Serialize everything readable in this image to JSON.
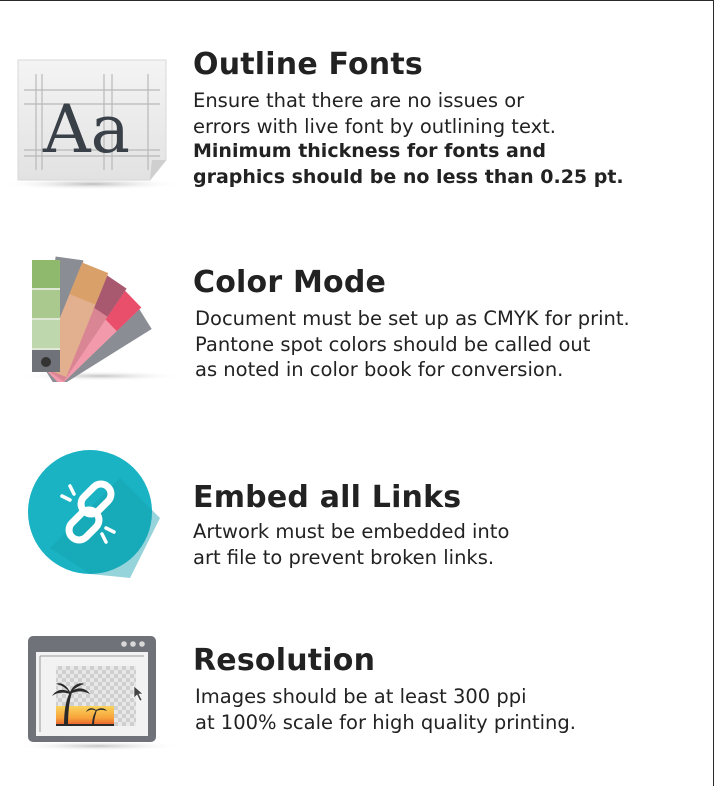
{
  "sections": [
    {
      "icon": "font-outline-icon",
      "title": "Outline Fonts",
      "body": [
        "Ensure that there are no issues or",
        "errors with live font by outlining text."
      ],
      "bold": [
        "Minimum thickness for fonts and",
        "graphics should be no less than 0.25 pt."
      ],
      "icon_text": "Aa"
    },
    {
      "icon": "color-swatch-fan-icon",
      "title": "Color Mode",
      "body": [
        "Document must be set up as CMYK for print.",
        "Pantone spot colors should be called out",
        "as noted in color book for conversion."
      ]
    },
    {
      "icon": "broken-link-icon",
      "title": "Embed all Links",
      "body": [
        "Artwork must be embedded into",
        "art file to prevent broken links."
      ]
    },
    {
      "icon": "image-resolution-icon",
      "title": "Resolution",
      "body": [
        "Images should be at least 300 ppi",
        "at 100% scale for high quality printing."
      ]
    }
  ],
  "colors": {
    "text": "#222222",
    "link_circle": "#1ab3c3",
    "swatches": [
      "#8fba6e",
      "#d9a06a",
      "#c48a7a",
      "#a8596f",
      "#e94f6b",
      "#f2889a",
      "#8a8d94"
    ]
  }
}
